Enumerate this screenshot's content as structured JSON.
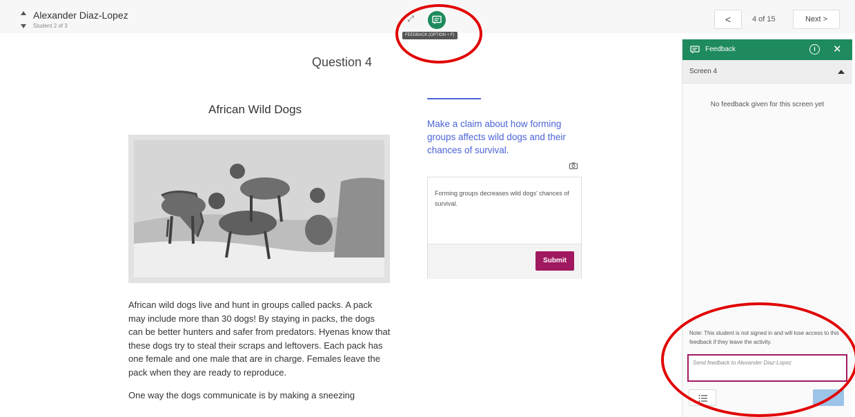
{
  "header": {
    "student_name": "Alexander Diaz-Lopez",
    "student_position": "Student 2 of 3",
    "feedback_tooltip": "FEEDBACK (OPTION + F)",
    "pager_prev_label": "<",
    "pager_count": "4 of 15",
    "pager_next_label": "Next >"
  },
  "content": {
    "question_title": "Question 4",
    "article_title": "African Wild Dogs",
    "passage": [
      "African wild dogs live and hunt in groups called packs. A pack may include more than 30 dogs! By staying in packs, the dogs can be better hunters and safer from predators. Hyenas know that these dogs try to steal their scraps and leftovers. Each pack has one female and one male that are in charge. Females leave the pack when they are ready to reproduce.",
      "One way the dogs communicate is by making a sneezing"
    ],
    "prompt": "Make a claim about how forming groups affects wild dogs and their chances of survival.",
    "response": "Forming groups decreases wild dogs' chances of survival.",
    "submit_label": "Submit"
  },
  "feedback_panel": {
    "title": "Feedback",
    "info_label": "i",
    "close_label": "✕",
    "screen_label": "Screen 4",
    "empty_message": "No feedback given for this screen yet",
    "note": "Note: This student is not signed in and will lose access to this feedback if they leave the activity.",
    "input_placeholder": "Send feedback to Alexander Diaz-Lopez"
  },
  "colors": {
    "accent_green": "#1e8a5e",
    "prompt_blue": "#4a63d8",
    "submit_magenta": "#a0185f",
    "highlight_red": "#e10000",
    "send_blue": "#9cc4e8"
  },
  "icons": [
    "expand-icon",
    "feedback-icon",
    "camera-icon",
    "info-icon",
    "close-icon",
    "list-icon",
    "chevron-left-icon",
    "chevron-right-icon"
  ]
}
